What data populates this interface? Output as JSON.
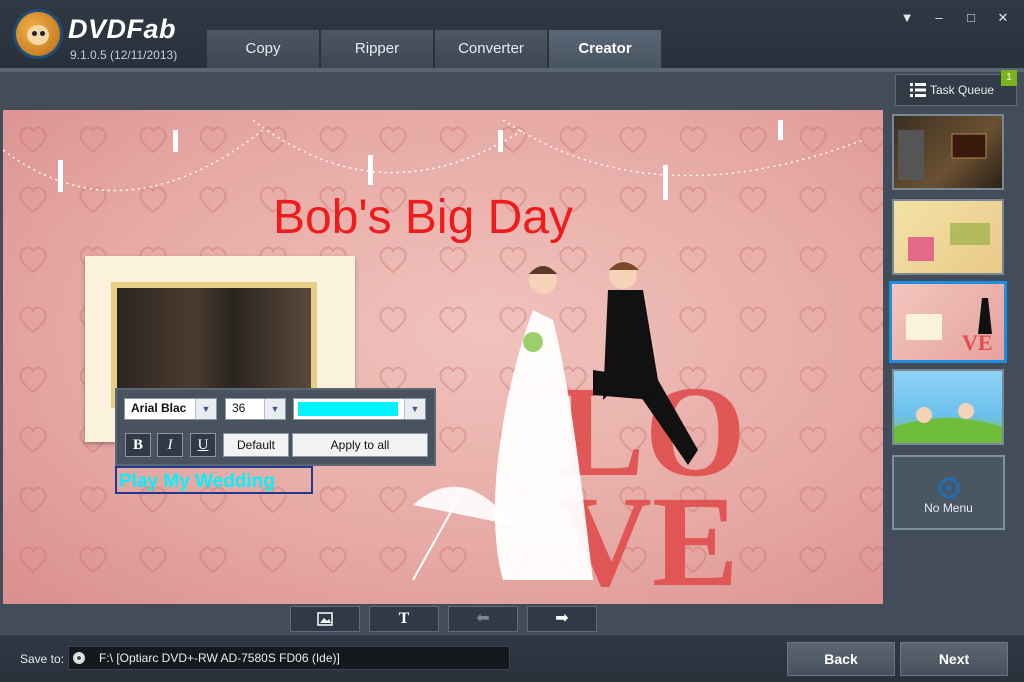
{
  "app": {
    "brand": "DVDFab",
    "version": "9.1.0.5 (12/11/2013)"
  },
  "tabs": [
    {
      "label": "Copy",
      "active": false
    },
    {
      "label": "Ripper",
      "active": false
    },
    {
      "label": "Converter",
      "active": false
    },
    {
      "label": "Creator",
      "active": true
    }
  ],
  "window_controls": {
    "dropdown": "▼",
    "minimize": "–",
    "maximize": "□",
    "close": "✕"
  },
  "preview": {
    "menu_title": "Bob's Big Day",
    "play_button_text": "Play My Wedding",
    "title_color": "#ee1c1c",
    "play_color": "#00f3ff"
  },
  "text_toolbox": {
    "font": "Arial Blac",
    "size": "36",
    "color": "#00f3ff",
    "bold": "B",
    "italic": "I",
    "underline": "U",
    "default_label": "Default",
    "apply_all_label": "Apply to all"
  },
  "bottom_tools": {
    "image": "🖼",
    "text": "T",
    "back": "⬅",
    "forward": "➡"
  },
  "sidebar": {
    "task_queue_label": "Task Queue",
    "task_queue_count": "1",
    "templates": [
      {
        "name": "template-bluray-film"
      },
      {
        "name": "template-birthday"
      },
      {
        "name": "template-wedding"
      },
      {
        "name": "template-kids"
      }
    ],
    "no_menu_label": "No Menu"
  },
  "footer": {
    "save_to_label": "Save to:",
    "save_to_value": "F:\\ [Optiarc DVD+-RW AD-7580S FD06 (Ide)]",
    "back_label": "Back",
    "next_label": "Next"
  }
}
